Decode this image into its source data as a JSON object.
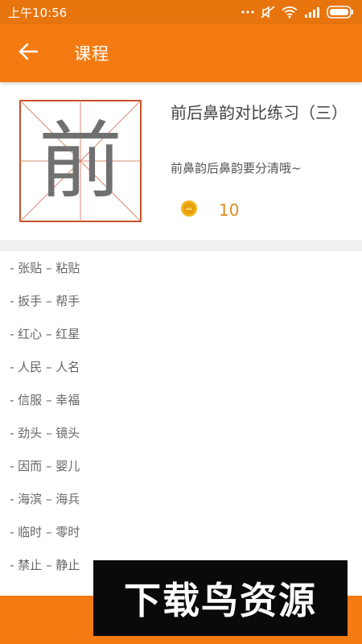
{
  "status_bar": {
    "time": "上午10:56"
  },
  "app_bar": {
    "title": "课程"
  },
  "course": {
    "character": "前",
    "title": "前后鼻韵对比练习（三）",
    "subtitle": "前鼻韵后鼻韵要分清哦~",
    "coins": "10"
  },
  "words": [
    "- 张贴 – 粘贴",
    "- 扳手 – 帮手",
    "- 红心 – 红星",
    "- 人民 – 人名",
    "- 信服 – 幸福",
    "- 劲头 – 镜头",
    "- 因而 – 婴儿",
    "- 海滨 – 海兵",
    "- 临时 – 零时",
    "- 禁止 – 静止"
  ],
  "watermark": {
    "text": "下载鸟资源"
  },
  "icons": {
    "back": "arrow-left-icon",
    "coin": "coin-icon",
    "wifi": "wifi-icon",
    "signal": "signal-icon",
    "battery": "battery-icon"
  },
  "colors": {
    "accent": "#f47b12",
    "status_bar": "#e8740e",
    "grid_line": "#c8502a",
    "coin_text": "#d99020"
  }
}
